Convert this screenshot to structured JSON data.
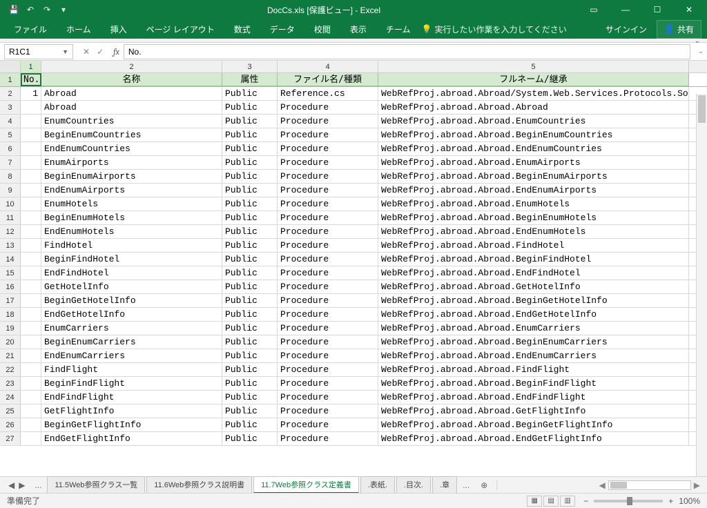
{
  "title": "DocCs.xls  [保護ビュー] - Excel",
  "qat_icons": [
    "save-icon",
    "undo-icon",
    "redo-icon",
    "customize-icon"
  ],
  "ribbon": {
    "tabs": [
      "ファイル",
      "ホーム",
      "挿入",
      "ページ レイアウト",
      "数式",
      "データ",
      "校閲",
      "表示",
      "チーム"
    ],
    "tell": "実行したい作業を入力してください",
    "signin": "サインイン",
    "share": "共有"
  },
  "namebox": "R1C1",
  "formula": "No.",
  "columns": [
    "1",
    "2",
    "3",
    "4",
    "5"
  ],
  "headers": [
    "No.",
    "名称",
    "属性",
    "ファイル名/種類",
    "フルネーム/継承"
  ],
  "rows": [
    {
      "n": "2",
      "no": "1",
      "name": "Abroad",
      "attr": "Public",
      "file": "Reference.cs",
      "full": "WebRefProj.abroad.Abroad/System.Web.Services.Protocols.So"
    },
    {
      "n": "3",
      "no": "",
      "name": "Abroad",
      "attr": "Public",
      "file": "Procedure",
      "full": "WebRefProj.abroad.Abroad.Abroad"
    },
    {
      "n": "4",
      "no": "",
      "name": "EnumCountries",
      "attr": "Public",
      "file": "Procedure",
      "full": "WebRefProj.abroad.Abroad.EnumCountries"
    },
    {
      "n": "5",
      "no": "",
      "name": "BeginEnumCountries",
      "attr": "Public",
      "file": "Procedure",
      "full": "WebRefProj.abroad.Abroad.BeginEnumCountries"
    },
    {
      "n": "6",
      "no": "",
      "name": "EndEnumCountries",
      "attr": "Public",
      "file": "Procedure",
      "full": "WebRefProj.abroad.Abroad.EndEnumCountries"
    },
    {
      "n": "7",
      "no": "",
      "name": "EnumAirports",
      "attr": "Public",
      "file": "Procedure",
      "full": "WebRefProj.abroad.Abroad.EnumAirports"
    },
    {
      "n": "8",
      "no": "",
      "name": "BeginEnumAirports",
      "attr": "Public",
      "file": "Procedure",
      "full": "WebRefProj.abroad.Abroad.BeginEnumAirports"
    },
    {
      "n": "9",
      "no": "",
      "name": "EndEnumAirports",
      "attr": "Public",
      "file": "Procedure",
      "full": "WebRefProj.abroad.Abroad.EndEnumAirports"
    },
    {
      "n": "10",
      "no": "",
      "name": "EnumHotels",
      "attr": "Public",
      "file": "Procedure",
      "full": "WebRefProj.abroad.Abroad.EnumHotels"
    },
    {
      "n": "11",
      "no": "",
      "name": "BeginEnumHotels",
      "attr": "Public",
      "file": "Procedure",
      "full": "WebRefProj.abroad.Abroad.BeginEnumHotels"
    },
    {
      "n": "12",
      "no": "",
      "name": "EndEnumHotels",
      "attr": "Public",
      "file": "Procedure",
      "full": "WebRefProj.abroad.Abroad.EndEnumHotels"
    },
    {
      "n": "13",
      "no": "",
      "name": "FindHotel",
      "attr": "Public",
      "file": "Procedure",
      "full": "WebRefProj.abroad.Abroad.FindHotel"
    },
    {
      "n": "14",
      "no": "",
      "name": "BeginFindHotel",
      "attr": "Public",
      "file": "Procedure",
      "full": "WebRefProj.abroad.Abroad.BeginFindHotel"
    },
    {
      "n": "15",
      "no": "",
      "name": "EndFindHotel",
      "attr": "Public",
      "file": "Procedure",
      "full": "WebRefProj.abroad.Abroad.EndFindHotel"
    },
    {
      "n": "16",
      "no": "",
      "name": "GetHotelInfo",
      "attr": "Public",
      "file": "Procedure",
      "full": "WebRefProj.abroad.Abroad.GetHotelInfo"
    },
    {
      "n": "17",
      "no": "",
      "name": "BeginGetHotelInfo",
      "attr": "Public",
      "file": "Procedure",
      "full": "WebRefProj.abroad.Abroad.BeginGetHotelInfo"
    },
    {
      "n": "18",
      "no": "",
      "name": "EndGetHotelInfo",
      "attr": "Public",
      "file": "Procedure",
      "full": "WebRefProj.abroad.Abroad.EndGetHotelInfo"
    },
    {
      "n": "19",
      "no": "",
      "name": "EnumCarriers",
      "attr": "Public",
      "file": "Procedure",
      "full": "WebRefProj.abroad.Abroad.EnumCarriers"
    },
    {
      "n": "20",
      "no": "",
      "name": "BeginEnumCarriers",
      "attr": "Public",
      "file": "Procedure",
      "full": "WebRefProj.abroad.Abroad.BeginEnumCarriers"
    },
    {
      "n": "21",
      "no": "",
      "name": "EndEnumCarriers",
      "attr": "Public",
      "file": "Procedure",
      "full": "WebRefProj.abroad.Abroad.EndEnumCarriers"
    },
    {
      "n": "22",
      "no": "",
      "name": "FindFlight",
      "attr": "Public",
      "file": "Procedure",
      "full": "WebRefProj.abroad.Abroad.FindFlight"
    },
    {
      "n": "23",
      "no": "",
      "name": "BeginFindFlight",
      "attr": "Public",
      "file": "Procedure",
      "full": "WebRefProj.abroad.Abroad.BeginFindFlight"
    },
    {
      "n": "24",
      "no": "",
      "name": "EndFindFlight",
      "attr": "Public",
      "file": "Procedure",
      "full": "WebRefProj.abroad.Abroad.EndFindFlight"
    },
    {
      "n": "25",
      "no": "",
      "name": "GetFlightInfo",
      "attr": "Public",
      "file": "Procedure",
      "full": "WebRefProj.abroad.Abroad.GetFlightInfo"
    },
    {
      "n": "26",
      "no": "",
      "name": "BeginGetFlightInfo",
      "attr": "Public",
      "file": "Procedure",
      "full": "WebRefProj.abroad.Abroad.BeginGetFlightInfo"
    },
    {
      "n": "27",
      "no": "",
      "name": "EndGetFlightInfo",
      "attr": "Public",
      "file": "Procedure",
      "full": "WebRefProj.abroad.Abroad.EndGetFlightInfo"
    }
  ],
  "sheets": {
    "prev": "...",
    "list": [
      "11.5Web参照クラス一覧",
      "11.6Web参照クラス説明書",
      "11.7Web参照クラス定義書",
      ".表紙.",
      ".目次.",
      ".章"
    ],
    "active": 2,
    "more": "..."
  },
  "status": {
    "ready": "準備完了",
    "zoom": "100%"
  }
}
